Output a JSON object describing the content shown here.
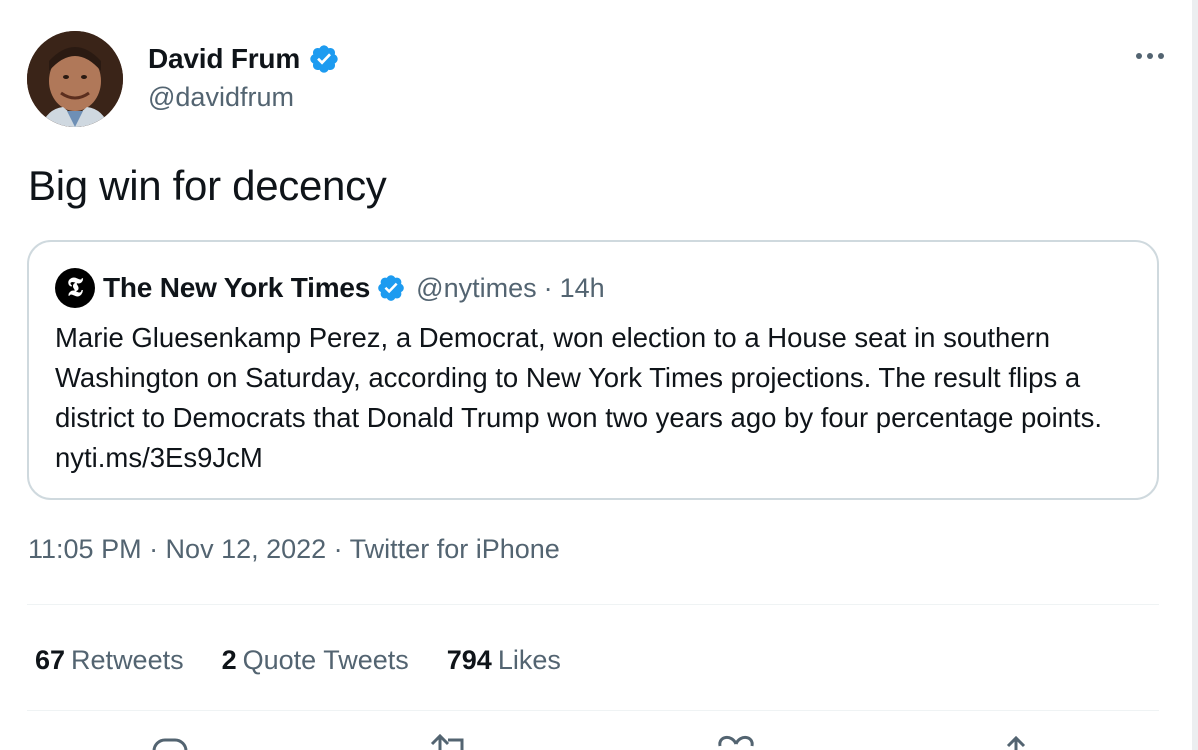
{
  "author": {
    "display_name": "David Frum",
    "handle": "@davidfrum",
    "verified": true
  },
  "tweet": {
    "text": "Big win for decency"
  },
  "quoted_tweet": {
    "display_name": "The New York Times",
    "handle": "@nytimes",
    "separator": "·",
    "time_ago": "14h",
    "logo_glyph": "𝕿",
    "body": "Marie Gluesenkamp Perez, a Democrat, won election to a House seat in southern Washington on Saturday, according to New York Times projections. The result flips a district to Democrats that Donald Trump won two years ago by four percentage points. nyti.ms/3Es9JcM"
  },
  "meta": {
    "timestamp": "11:05 PM · Nov 12, 2022 · Twitter for iPhone"
  },
  "stats": [
    {
      "count": "67",
      "label": "Retweets"
    },
    {
      "count": "2",
      "label": "Quote Tweets"
    },
    {
      "count": "794",
      "label": "Likes"
    }
  ],
  "icons": {
    "verified": "verified-badge-icon",
    "more": "more-options-icon",
    "reply": "reply-icon",
    "retweet": "retweet-icon",
    "like": "like-icon",
    "share": "share-icon"
  },
  "colors": {
    "verified_blue": "#1d9bf0",
    "secondary_text": "#536471",
    "border": "#cfd9de"
  }
}
